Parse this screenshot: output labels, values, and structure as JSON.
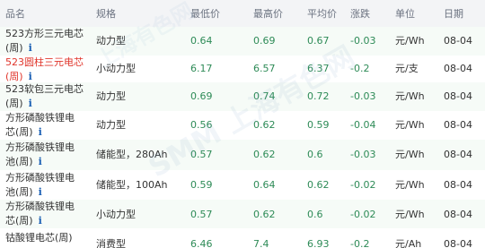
{
  "header": {
    "name": "品名",
    "spec": "规格",
    "low": "最低价",
    "high": "最高价",
    "avg": "平均价",
    "change": "涨跌",
    "unit": "单位",
    "date": "日期"
  },
  "watermark": "SMM 上海有色网",
  "watermark_top": "上海有色网",
  "info_icon_glyph": "i",
  "colors": {
    "price_green": "#2e8b57",
    "product_red": "#e0352b",
    "info_blue": "#1a5fb4"
  },
  "rows": [
    {
      "name_line1": "523方形三元电芯",
      "name_line2": "(周)",
      "spec": "动力型",
      "low": "0.64",
      "high": "0.69",
      "avg": "0.67",
      "change": "-0.03",
      "unit": "元/Wh",
      "date": "08-04"
    },
    {
      "name_line1": "523圆柱三元电芯",
      "name_line2": "(周)",
      "spec": "小动力型",
      "low": "6.17",
      "high": "6.57",
      "avg": "6.37",
      "change": "-0.2",
      "unit": "元/支",
      "date": "08-04"
    },
    {
      "name_line1": "523软包三元电芯",
      "name_line2": "(周)",
      "spec": "动力型",
      "low": "0.69",
      "high": "0.74",
      "avg": "0.72",
      "change": "-0.03",
      "unit": "元/Wh",
      "date": "08-04"
    },
    {
      "name_line1": "方形磷酸铁锂电",
      "name_line2": "芯(周)",
      "spec": "动力型",
      "low": "0.56",
      "high": "0.62",
      "avg": "0.59",
      "change": "-0.04",
      "unit": "元/Wh",
      "date": "08-04"
    },
    {
      "name_line1": "方形磷酸铁锂电",
      "name_line2": "池(周)",
      "spec": "储能型，280Ah",
      "low": "0.57",
      "high": "0.62",
      "avg": "0.6",
      "change": "-0.03",
      "unit": "元/Wh",
      "date": "08-04"
    },
    {
      "name_line1": "方形磷酸铁锂电",
      "name_line2": "池(周)",
      "spec": "储能型，100Ah",
      "low": "0.59",
      "high": "0.64",
      "avg": "0.62",
      "change": "-0.02",
      "unit": "元/Wh",
      "date": "08-04"
    },
    {
      "name_line1": "方形磷酸铁锂电",
      "name_line2": "芯(周)",
      "spec": "小动力型",
      "low": "0.57",
      "high": "0.62",
      "avg": "0.6",
      "change": "-0.02",
      "unit": "元/Wh",
      "date": "08-04"
    },
    {
      "name_line1": "钴酸锂电芯(周)",
      "name_line2": "",
      "spec": "消费型",
      "low": "6.46",
      "high": "7.4",
      "avg": "6.93",
      "change": "-0.2",
      "unit": "元/Ah",
      "date": "08-04"
    }
  ]
}
